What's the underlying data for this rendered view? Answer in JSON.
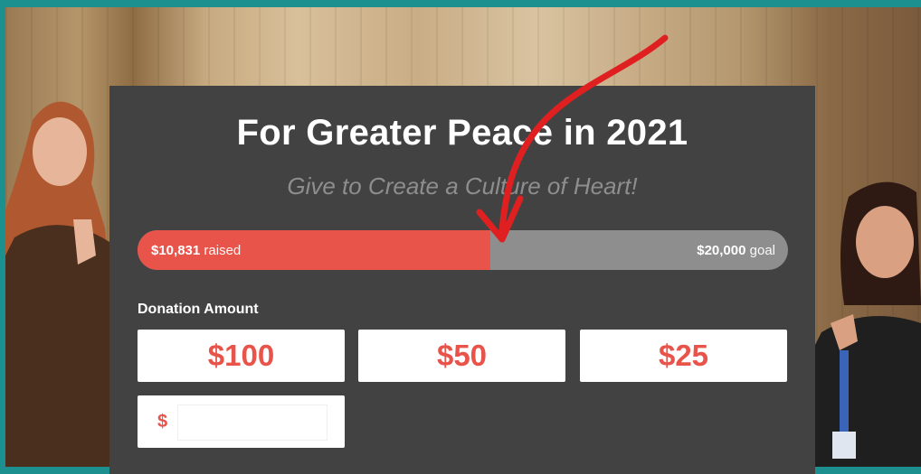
{
  "campaign": {
    "title": "For Greater Peace in 2021",
    "subtitle": "Give to Create a Culture of Heart!"
  },
  "progress": {
    "raised_amount": "$10,831",
    "raised_suffix": " raised",
    "goal_amount": "$20,000",
    "goal_suffix": " goal",
    "fraction": 0.542
  },
  "donation": {
    "label": "Donation Amount",
    "options": [
      "$100",
      "$50",
      "$25"
    ],
    "custom_currency": "$",
    "custom_value": ""
  },
  "colors": {
    "accent": "#e8534a",
    "card_bg": "#424242",
    "bar_bg": "#8e8e8e",
    "frame": "#1c8f8f",
    "arrow": "#e02020"
  }
}
